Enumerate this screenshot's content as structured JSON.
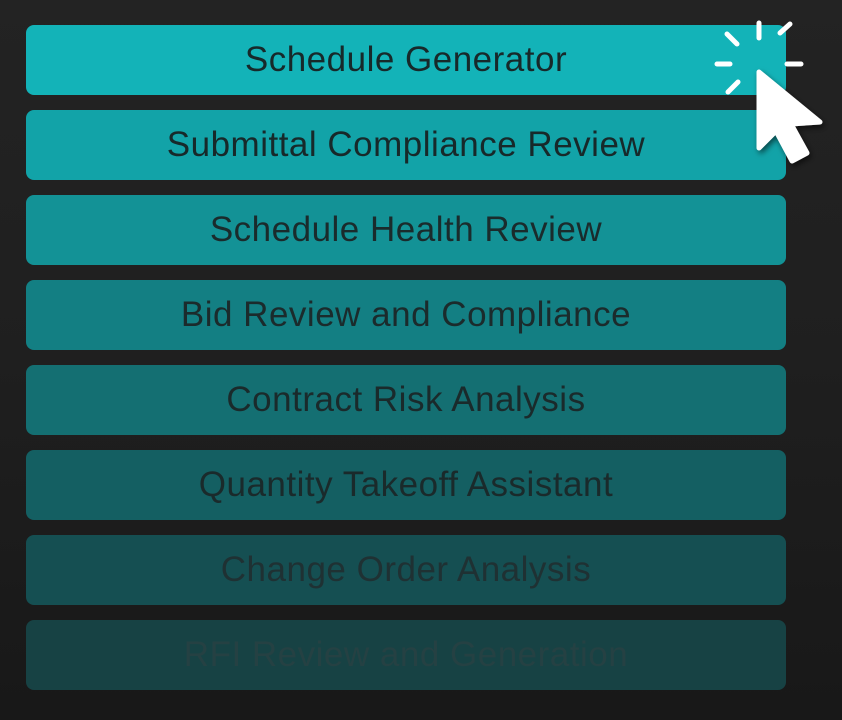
{
  "menu": {
    "items": [
      {
        "label": "Schedule Generator",
        "bg": "#13b3b8",
        "fg": "#17292a"
      },
      {
        "label": "Submittal Compliance Review",
        "bg": "#12a3a8",
        "fg": "#17292a"
      },
      {
        "label": "Schedule Health Review",
        "bg": "#139296",
        "fg": "#1a2b2c"
      },
      {
        "label": "Bid Review and Compliance",
        "bg": "#137f83",
        "fg": "#1b2b2c"
      },
      {
        "label": "Contract Risk Analysis",
        "bg": "#146f72",
        "fg": "#1a2a2b"
      },
      {
        "label": "Quantity Takeoff Assistant",
        "bg": "#145f62",
        "fg": "#1a2a2b"
      },
      {
        "label": "Change Order Analysis",
        "bg": "#154f52",
        "fg": "#1f3133"
      },
      {
        "label": "RFI Review and Generation",
        "bg": "#174244",
        "fg": "#254143"
      }
    ]
  },
  "cursor": {
    "icon": "hand-pointer-click-icon",
    "color": "#ffffff"
  }
}
